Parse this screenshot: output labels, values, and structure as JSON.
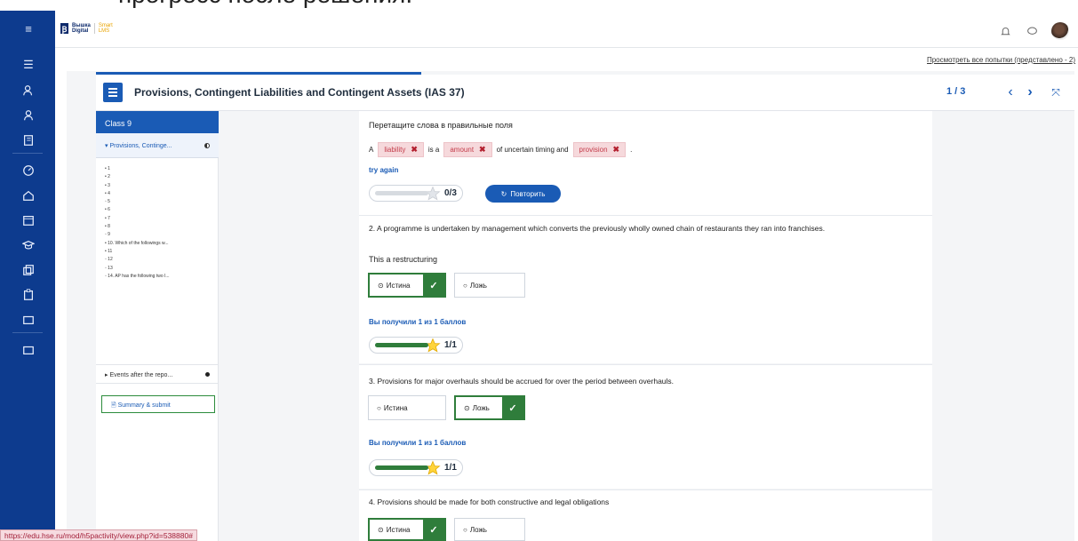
{
  "caption": "прогресс после решения.",
  "header": {
    "logo_line1": "Вышка",
    "logo_line2": "Digital",
    "logo_smart": "Smart",
    "logo_lms": "LMS"
  },
  "attempts_link": "Просмотреть все попытки (представлено - 2)",
  "activity": {
    "title": "Provisions, Contingent Liabilities and Contingent Assets (IAS 37)",
    "counter": "1 / 3"
  },
  "sidebar": {
    "header": "Class 9",
    "section1": "Provisions, Continge...",
    "items": [
      "• 1",
      "• 2",
      "• 3",
      "• 4",
      "◦ 5",
      "• 6",
      "• 7",
      "• 8",
      "◦ 9",
      "• 10. Which of the followings w...",
      "• 11",
      "◦ 12",
      "◦ 13",
      "◦ 14. AP has the following two I..."
    ],
    "section2": "Events after the repo...",
    "summary": "Summary & submit"
  },
  "q1": {
    "instruction": "Перетащите слова в правильные поля",
    "prefix": "A",
    "word1": "liability",
    "mid1": "is a",
    "word2": "amount",
    "mid2": "of uncertain timing and",
    "word3": "provision",
    "suffix": ".",
    "try_again": "try again",
    "score": "0/3",
    "score_fraction": 0.0,
    "retry": "Повторить"
  },
  "q2": {
    "text": "2. A programme is undertaken by management which converts the previously wholly owned chain of restaurants they ran into franchises.",
    "statement": "This a restructuring",
    "true_label": "Истина",
    "false_label": "Ложь",
    "earned": "Вы получили 1 из 1 баллов",
    "score": "1/1",
    "score_fraction": 1.0
  },
  "q3": {
    "text": "3. Provisions for major overhauls should be accrued for over the period between overhauls.",
    "true_label": "Истина",
    "false_label": "Ложь",
    "earned": "Вы получили 1 из 1 баллов",
    "score": "1/1",
    "score_fraction": 1.0
  },
  "q4": {
    "text": "4. Provisions should be made for both constructive and legal obligations",
    "true_label": "Истина",
    "false_label": "Ложь"
  },
  "status_url": "https://edu.hse.ru/mod/h5pactivity/view.php?id=538880#",
  "colors": {
    "nav": "#0d3b8e",
    "accent": "#1a5bb5",
    "correct": "#2f7d3b",
    "wrong_chip": "#f6d9dc"
  }
}
